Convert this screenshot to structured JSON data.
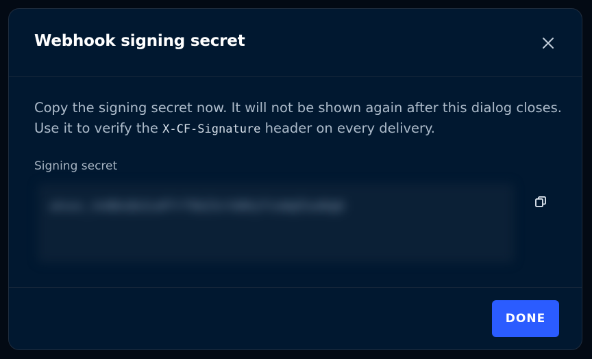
{
  "dialog": {
    "title": "Webhook signing secret",
    "description_before": "Copy the signing secret now. It will not be shown again after this dialog closes. Use it to verify the ",
    "description_code": "X-CF-Signature",
    "description_after": " header on every delivery.",
    "field_label": "Signing secret",
    "secret_value": "whsec_4vN8xQk2LmP7rT9bZ3cYdH6jF1sWqE5uA0gK",
    "done_label": "DONE",
    "icons": {
      "close": "close-icon",
      "copy": "copy-icon"
    },
    "accent_color": "#2b5cff"
  }
}
